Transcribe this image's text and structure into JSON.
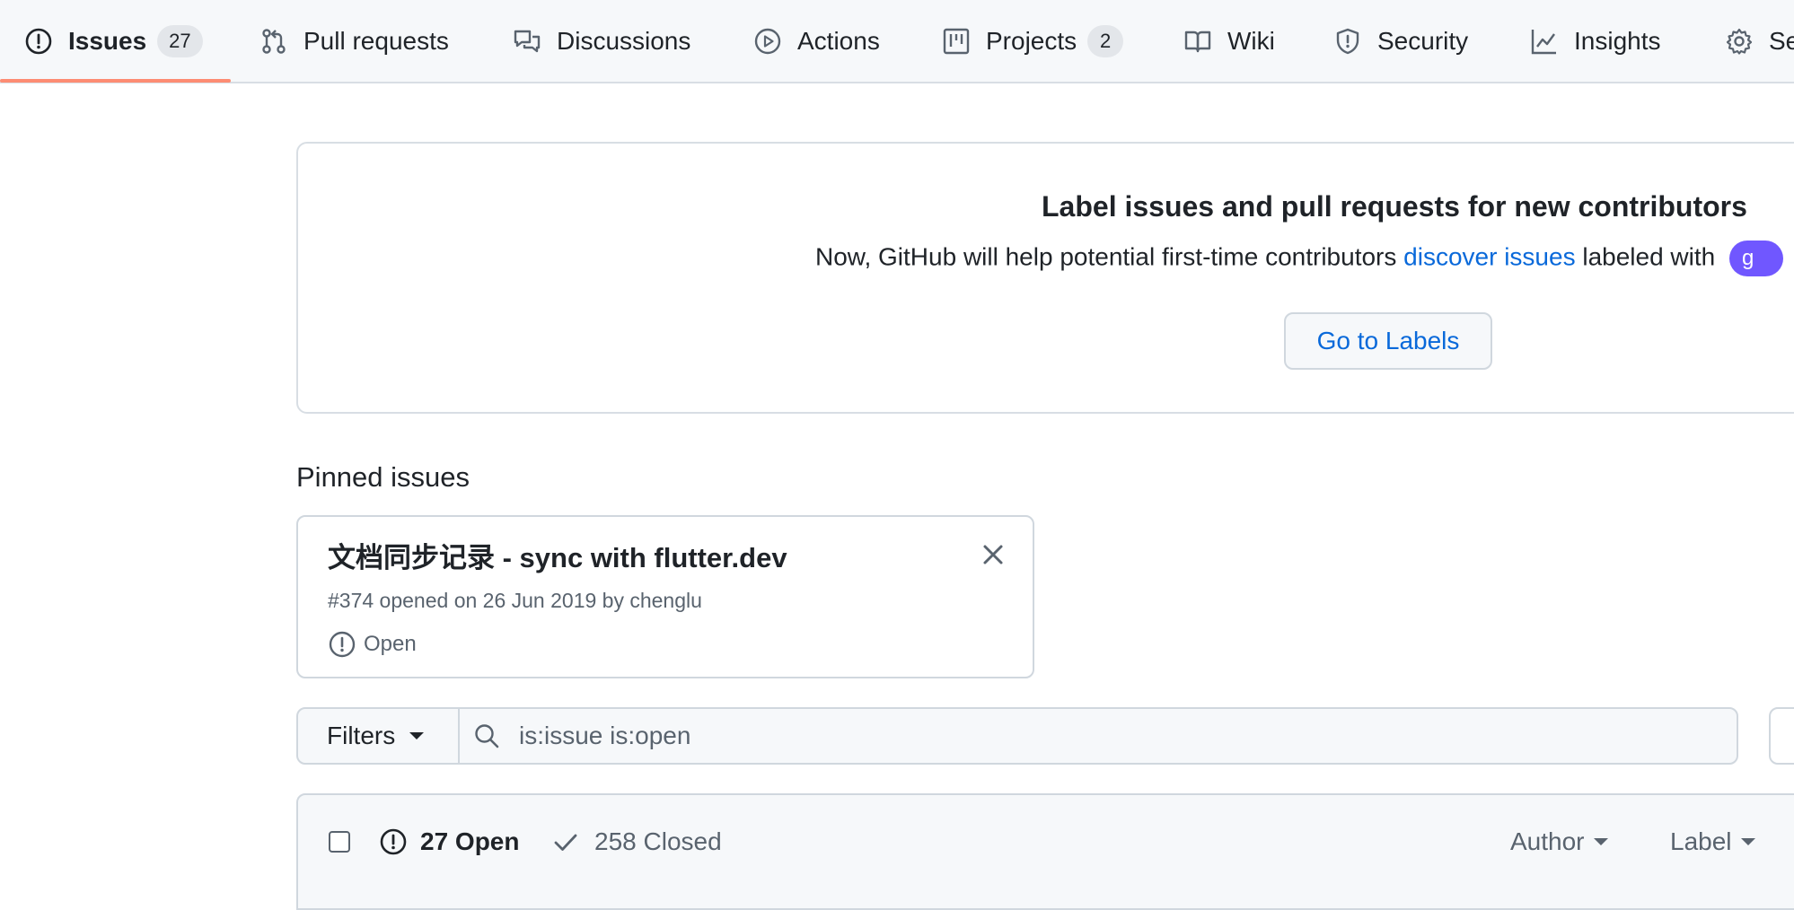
{
  "nav": {
    "tabs": [
      {
        "label": "Issues",
        "icon": "issue-opened-icon",
        "count": "27",
        "active": true
      },
      {
        "label": "Pull requests",
        "icon": "git-pull-request-icon"
      },
      {
        "label": "Discussions",
        "icon": "comment-discussion-icon"
      },
      {
        "label": "Actions",
        "icon": "play-icon"
      },
      {
        "label": "Projects",
        "icon": "table-icon",
        "count": "2"
      },
      {
        "label": "Wiki",
        "icon": "book-icon"
      },
      {
        "label": "Security",
        "icon": "shield-icon"
      },
      {
        "label": "Insights",
        "icon": "graph-icon"
      },
      {
        "label": "Se",
        "icon": "gear-icon"
      }
    ]
  },
  "banner": {
    "title": "Label issues and pull requests for new contributors",
    "text_before": "Now, GitHub will help potential first-time contributors ",
    "link": "discover issues",
    "text_after": " labeled with ",
    "label_pill": "g",
    "button": "Go to Labels",
    "label_color": "#7057ff"
  },
  "pinned": {
    "heading": "Pinned issues",
    "issue": {
      "title": "文档同步记录 - sync with flutter.dev",
      "meta": "#374 opened on 26 Jun 2019 by chenglu",
      "status": "Open"
    }
  },
  "filters": {
    "button": "Filters",
    "search_value": "is:issue is:open"
  },
  "list": {
    "open": "27 Open",
    "closed": "258 Closed",
    "author": "Author",
    "label": "Label"
  },
  "colors": {
    "accent_underline": "#fd8c73",
    "link": "#0969da"
  }
}
